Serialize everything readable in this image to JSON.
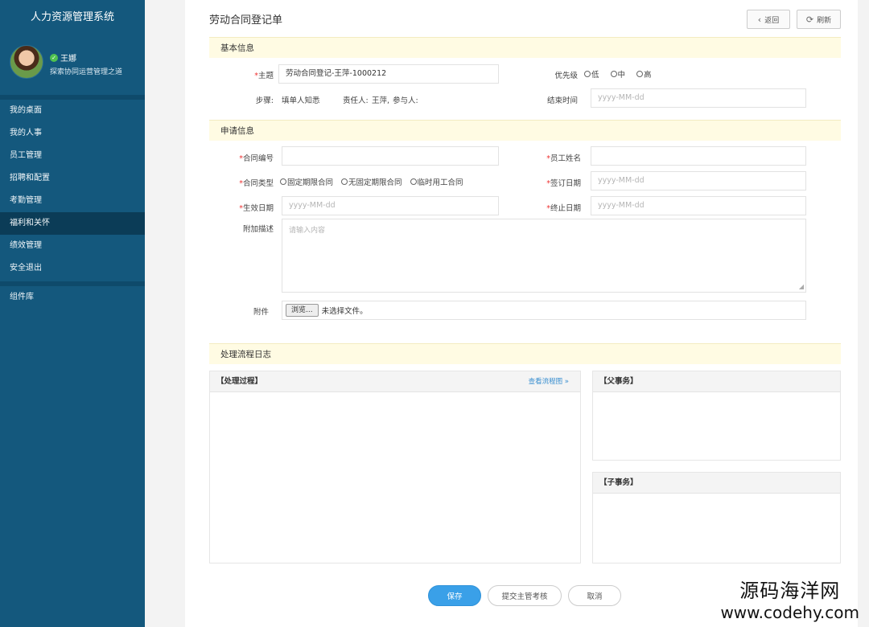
{
  "sidebar": {
    "app_title": "人力资源管理系统",
    "user_name": "王娜",
    "user_motto": "探索协同运营管理之道",
    "items": [
      {
        "label": "我的桌面"
      },
      {
        "label": "我的人事"
      },
      {
        "label": "员工管理"
      },
      {
        "label": "招聘和配置"
      },
      {
        "label": "考勤管理"
      },
      {
        "label": "福利和关怀"
      },
      {
        "label": "绩效管理"
      },
      {
        "label": "安全退出"
      }
    ],
    "active_index": 5,
    "extra_item": "组件库"
  },
  "header": {
    "title": "劳动合同登记单",
    "back_label": "返回",
    "refresh_label": "刷新"
  },
  "basic": {
    "section_title": "基本信息",
    "subject_label": "主题",
    "subject_value": "劳动合同登记-王萍-1000212",
    "priority_label": "优先级",
    "priority_options": [
      "低",
      "中",
      "高"
    ],
    "steps_label": "步骤:",
    "steps_value": "填单人知悉",
    "owner_label": "责任人:",
    "owner_value": "王萍,",
    "participant_label": "参与人:",
    "end_time_label": "结束时间",
    "date_placeholder": "yyyy-MM-dd"
  },
  "apply": {
    "section_title": "申请信息",
    "contract_no_label": "合同编号",
    "employee_name_label": "员工姓名",
    "contract_type_label": "合同类型",
    "contract_type_options": [
      "固定期限合同",
      "无固定期限合同",
      "临时用工合同"
    ],
    "sign_date_label": "签订日期",
    "effective_date_label": "生效日期",
    "end_date_label": "终止日期",
    "date_placeholder": "yyyy-MM-dd",
    "desc_label": "附加描述",
    "desc_placeholder": "请输入内容",
    "attachment_label": "附件",
    "browse_label": "浏览...",
    "no_file_label": "未选择文件。"
  },
  "log": {
    "section_title": "处理流程日志",
    "process_title": "【处理过程】",
    "view_flow_link": "查看流程图 »",
    "parent_title": "【父事务】",
    "child_title": "【子事务】"
  },
  "actions": {
    "save_label": "保存",
    "submit_label": "提交主管考核",
    "cancel_label": "取消"
  },
  "watermark": {
    "cn": "源码海洋网",
    "en": "www.codehy.com"
  }
}
